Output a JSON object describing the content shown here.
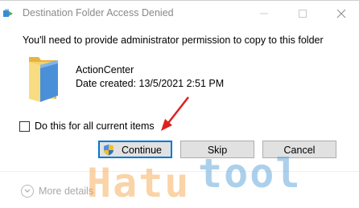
{
  "window": {
    "title": "Destination Folder Access Denied",
    "app_icon": "copy-files-icon",
    "controls": [
      "minimize-icon",
      "maximize-icon",
      "close-icon"
    ]
  },
  "message": "You'll need to provide administrator permission to copy to this folder",
  "item": {
    "icon": "folder-icon",
    "name": "ActionCenter",
    "date_created": "Date created: 13/5/2021 2:51 PM"
  },
  "checkbox": {
    "label": "Do this for all current items",
    "checked": false
  },
  "buttons": {
    "continue": "Continue",
    "skip": "Skip",
    "cancel": "Cancel"
  },
  "footer": {
    "more_details": "More details"
  },
  "watermark": {
    "part1": "Hatu",
    "part2": "tool",
    "color1": "#f49e3c",
    "color2": "#4696d2"
  },
  "colors": {
    "accent": "#0078d7",
    "annotation_arrow": "#e02020",
    "title_text": "#8a8a8a"
  }
}
